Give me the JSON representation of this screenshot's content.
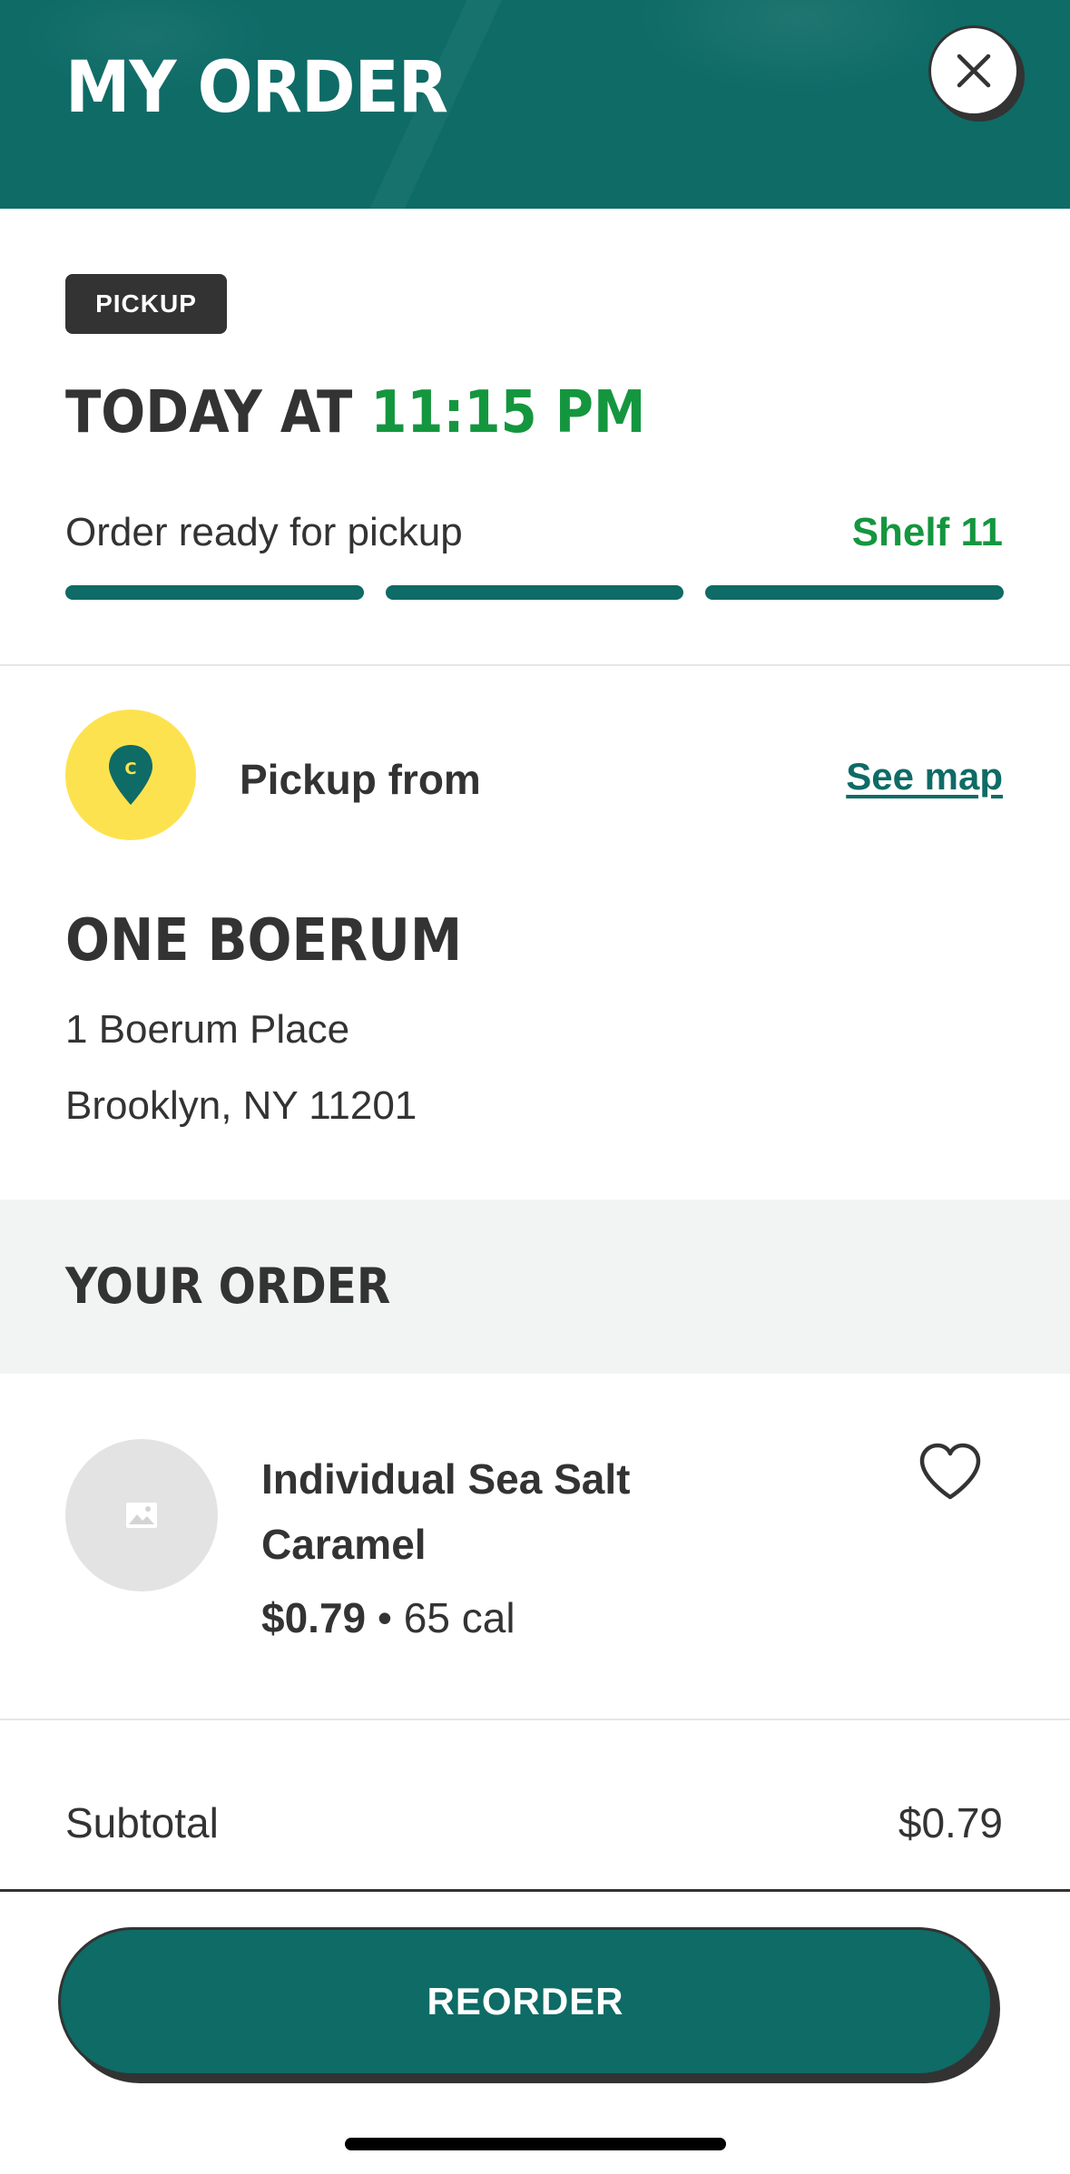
{
  "header": {
    "title": "MY ORDER",
    "close_icon": "close-icon",
    "background_color": "#0e6b66"
  },
  "order_status": {
    "badge": "PICKUP",
    "time_prefix": "TODAY AT",
    "time_value": "11:15 PM",
    "status_text": "Order ready for pickup",
    "shelf_text": "Shelf 11",
    "progress_steps_total": 3,
    "progress_steps_complete": 3,
    "accent_color": "#14963f"
  },
  "pickup_location": {
    "icon": "map-pin-icon",
    "label": "Pickup from",
    "see_map_link": "See map",
    "store_name": "ONE BOERUM",
    "address_line1": "1 Boerum Place",
    "address_line2": "Brooklyn, NY 11201"
  },
  "your_order": {
    "section_title": "YOUR ORDER",
    "items": [
      {
        "name": "Individual Sea Salt Caramel",
        "price": "$0.79",
        "separator": "•",
        "calories": "65 cal",
        "favorite_icon": "heart-icon",
        "thumbnail_icon": "image-placeholder-icon"
      }
    ]
  },
  "totals": {
    "subtotal_label": "Subtotal",
    "subtotal_value": "$0.79"
  },
  "footer": {
    "reorder_label": "REORDER"
  }
}
